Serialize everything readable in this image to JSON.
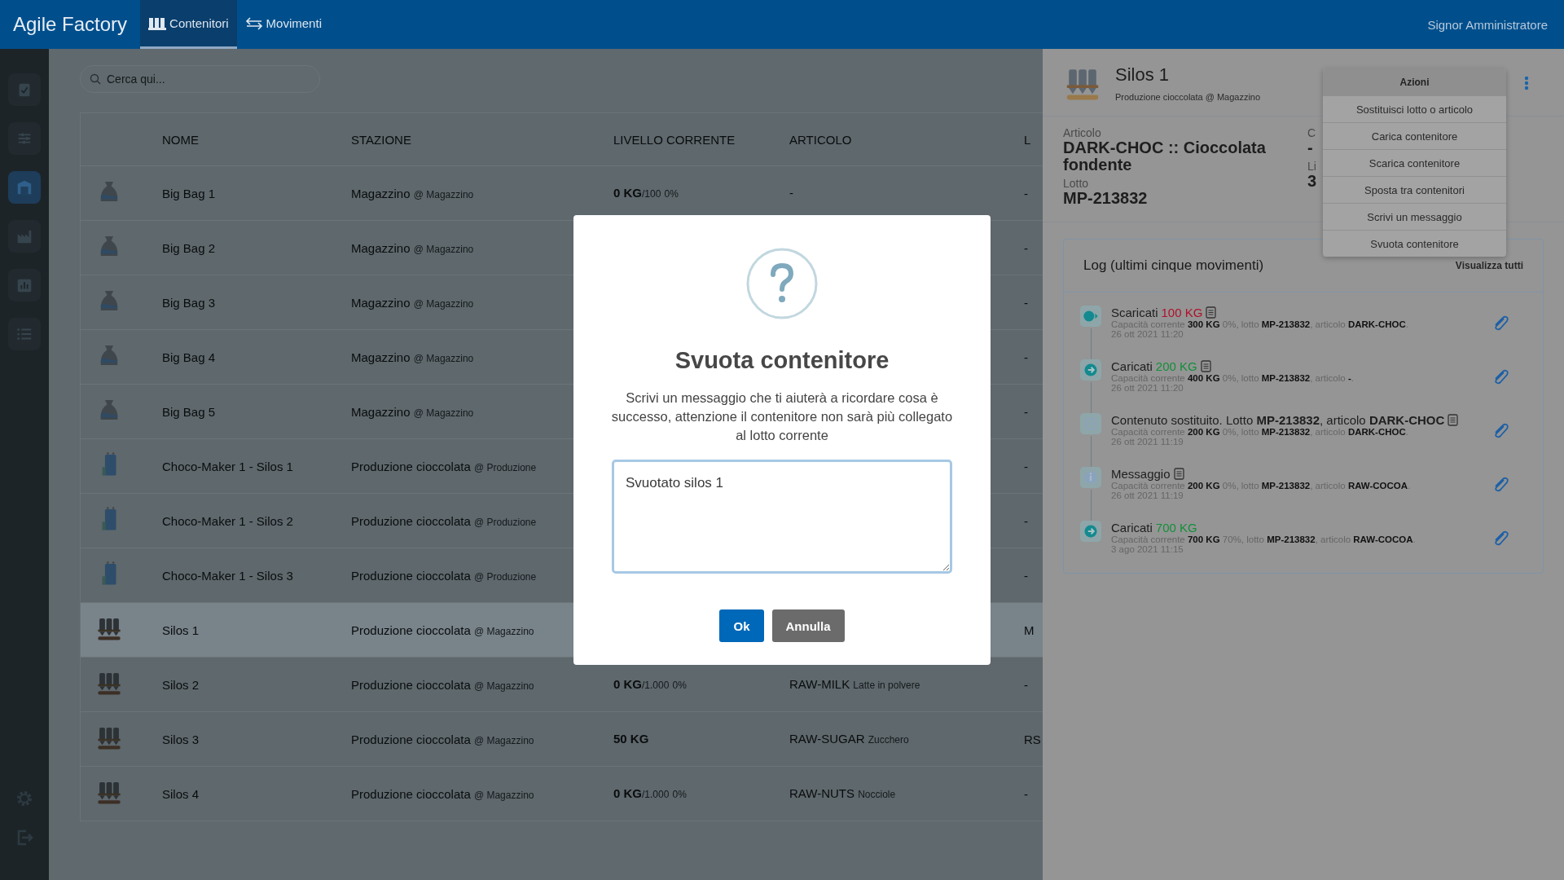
{
  "topbar": {
    "brand": "Agile Factory",
    "tabs": [
      {
        "label": "Contenitori",
        "selected": true
      },
      {
        "label": "Movimenti",
        "selected": false
      }
    ],
    "user": "Signor Amministratore"
  },
  "sidebar": {
    "items": [
      {
        "selected": false
      },
      {
        "selected": false
      },
      {
        "selected": true
      },
      {
        "selected": false
      },
      {
        "selected": false
      },
      {
        "selected": false
      }
    ]
  },
  "search": {
    "placeholder": "Cerca qui..."
  },
  "table": {
    "columns": [
      "NOME",
      "STAZIONE",
      "LIVELLO CORRENTE",
      "ARTICOLO",
      "L"
    ],
    "rows": [
      {
        "kind": "bag",
        "name": "Big Bag 1",
        "station": "Magazzino",
        "location": "@ Magazzino",
        "amount": "0 KG",
        "capacity": "/100",
        "percent": "0%",
        "article": "-",
        "lot": "-",
        "selected": false
      },
      {
        "kind": "bag",
        "name": "Big Bag 2",
        "station": "Magazzino",
        "location": "@ Magazzino",
        "lot": "-",
        "selected": false
      },
      {
        "kind": "bag",
        "name": "Big Bag 3",
        "station": "Magazzino",
        "location": "@ Magazzino",
        "lot": "-",
        "selected": false
      },
      {
        "kind": "bag",
        "name": "Big Bag 4",
        "station": "Magazzino",
        "location": "@ Magazzino",
        "lot": "-",
        "selected": false
      },
      {
        "kind": "bag",
        "name": "Big Bag 5",
        "station": "Magazzino",
        "location": "@ Magazzino",
        "lot": "-",
        "selected": false
      },
      {
        "kind": "maker",
        "name": "Choco-Maker 1 - Silos 1",
        "station": "Produzione cioccolata",
        "location": "@ Produzione",
        "lot": "-",
        "selected": false
      },
      {
        "kind": "maker",
        "name": "Choco-Maker 1 - Silos 2",
        "station": "Produzione cioccolata",
        "location": "@ Produzione",
        "lot": "-",
        "selected": false
      },
      {
        "kind": "maker",
        "name": "Choco-Maker 1 - Silos 3",
        "station": "Produzione cioccolata",
        "location": "@ Produzione",
        "lot": "-",
        "selected": false
      },
      {
        "kind": "silo",
        "name": "Silos 1",
        "station": "Produzione cioccolata",
        "location": "@ Magazzino",
        "lot": "M",
        "selected": true
      },
      {
        "kind": "silo",
        "name": "Silos 2",
        "station": "Produzione cioccolata",
        "location": "@ Magazzino",
        "amount": "0 KG",
        "capacity": "/1.000",
        "percent": "0%",
        "article": "RAW-MILK",
        "article_name": "Latte in polvere",
        "lot": "-",
        "selected": false
      },
      {
        "kind": "silo",
        "name": "Silos 3",
        "station": "Produzione cioccolata",
        "location": "@ Magazzino",
        "amount": "50 KG",
        "article": "RAW-SUGAR",
        "article_name": "Zucchero",
        "lot": "RS",
        "selected": false
      },
      {
        "kind": "silo",
        "name": "Silos 4",
        "station": "Produzione cioccolata",
        "location": "@ Magazzino",
        "amount": "0 KG",
        "capacity": "/1.000",
        "percent": "0%",
        "article": "RAW-NUTS",
        "article_name": "Nocciole",
        "lot": "-",
        "selected": false
      }
    ]
  },
  "detail": {
    "title": "Silos 1",
    "subtitle": "Produzione cioccolata @ Magazzino",
    "fields": [
      {
        "label": "Articolo",
        "value": "DARK-CHOC :: Cioccolata fondente"
      },
      {
        "label": "Lotto",
        "value": "MP-213832"
      }
    ],
    "fields_2": [
      {
        "label": "C",
        "value": "-"
      },
      {
        "label": "Li",
        "value": "3"
      }
    ],
    "log": {
      "title": "Log (ultimi cinque movimenti)",
      "link": "Visualizza tutti",
      "entries": [
        {
          "kind": "unload",
          "title": "Scaricati",
          "amount": "100 KG",
          "note": true,
          "detail": "Capacità corrente **300 KG** 0%, lotto **MP-213832**, articolo **DARK-CHOC**.",
          "date": "26 ott 2021 11:20"
        },
        {
          "kind": "load",
          "title": "Caricati",
          "amount": "200 KG",
          "note": true,
          "detail": "Capacità corrente **400 KG** 0%, lotto **MP-213832**, articolo **-**.",
          "date": "26 ott 2021 11:20"
        },
        {
          "kind": "replace",
          "title": "Contenuto sostituito. Lotto **MP-213832**, articolo **DARK-CHOC**",
          "note": true,
          "detail": "Capacità corrente **200 KG** 0%, lotto **MP-213832**, articolo **DARK-CHOC**.",
          "date": "26 ott 2021 11:19"
        },
        {
          "kind": "message",
          "title": "Messaggio",
          "note": true,
          "detail": "Capacità corrente **200 KG** 0%, lotto **MP-213832**, articolo **RAW-COCOA**.",
          "date": "26 ott 2021 11:19"
        },
        {
          "kind": "load",
          "title": "Caricati",
          "amount": "700 KG",
          "note": false,
          "detail": "Capacità corrente **700 KG** 70%, lotto **MP-213832**, articolo **RAW-COCOA**.",
          "date": "3 ago 2021 11:15"
        }
      ]
    },
    "menu": {
      "title": "Azioni",
      "items": [
        "Sostituisci lotto o articolo",
        "Carica contenitore",
        "Scarica contenitore",
        "Sposta tra contenitori",
        "Scrivi un messaggio",
        "Svuota contenitore"
      ]
    }
  },
  "dialog": {
    "title": "Svuota contenitore",
    "text": "Scrivi un messaggio che ti aiuterà a ricordare cosa è successo, attenzione il contenitore non sarà più collegato al lotto corrente",
    "value": "Svuotato silos 1",
    "buttons": [
      {
        "label": "Ok",
        "kind": "primary"
      },
      {
        "label": "Annulla",
        "kind": "secondary"
      }
    ]
  }
}
